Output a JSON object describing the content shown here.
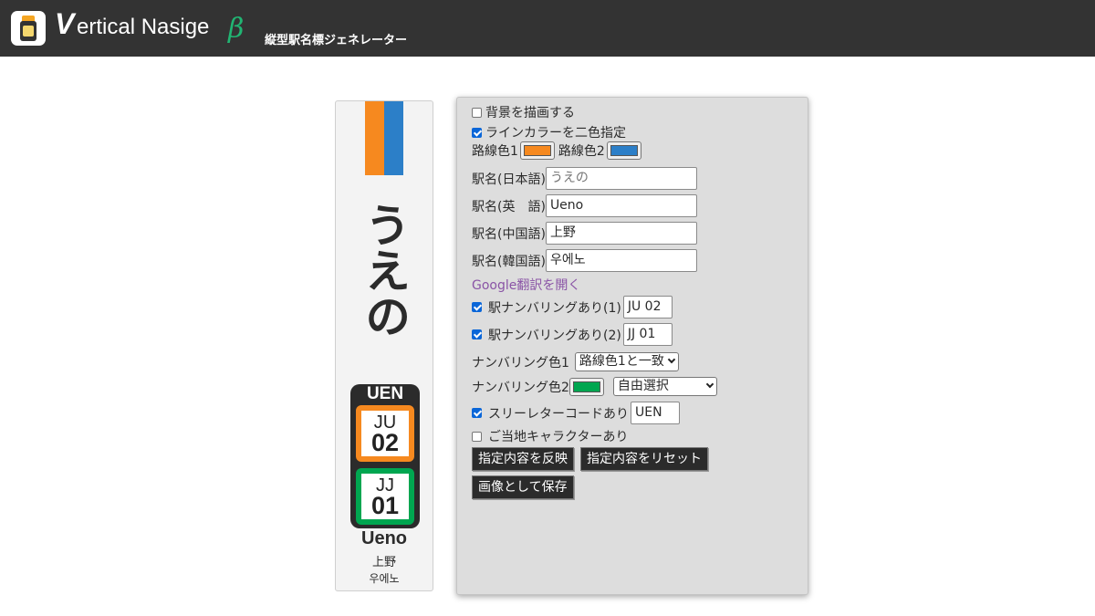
{
  "header": {
    "brand_v": "V",
    "brand_rest": "ertical Nasige",
    "brand_beta": "β",
    "subtitle": "縦型駅名標ジェネレーター",
    "logo_icon": "signboard-logo-icon"
  },
  "sign": {
    "line_color_1": "#f6891f",
    "line_color_2": "#2c7fc8",
    "name_jp": "うえの",
    "three_letter": "UEN",
    "numbering_1": {
      "line": "JU",
      "num": "02",
      "color": "#f6891f"
    },
    "numbering_2": {
      "line": "JJ",
      "num": "01",
      "color": "#00a650"
    },
    "name_en": "Ueno",
    "name_cn": "上野",
    "name_kr": "우에노"
  },
  "form": {
    "draw_background": {
      "label": "背景を描画する",
      "checked": false
    },
    "two_color_line": {
      "label": "ラインカラーを二色指定",
      "checked": true
    },
    "line_color_1_label": "路線色1",
    "line_color_2_label": "路線色2",
    "name_jp_label": "駅名(日本語)",
    "name_jp_placeholder": "うえの",
    "name_en_label": "駅名(英　語)",
    "name_en_value": "Ueno",
    "name_cn_label": "駅名(中国語)",
    "name_cn_value": "上野",
    "name_kr_label": "駅名(韓国語)",
    "name_kr_value": "우에노",
    "google_translate_link": "Google翻訳を開く",
    "numbering_1": {
      "label": "駅ナンバリングあり(1)",
      "checked": true,
      "value": "JU 02"
    },
    "numbering_2": {
      "label": "駅ナンバリングあり(2)",
      "checked": true,
      "value": "JJ 01"
    },
    "numbering_color_1_label": "ナンバリング色1",
    "numbering_color_1_select": "路線色1と一致",
    "numbering_color_2_label": "ナンバリング色2",
    "numbering_color_2_swatch": "#00a650",
    "numbering_color_2_select": "自由選択",
    "three_letter": {
      "label": "スリーレターコードあり",
      "checked": true,
      "value": "UEN"
    },
    "local_character": {
      "label": "ご当地キャラクターあり",
      "checked": false
    },
    "buttons": {
      "apply": "指定内容を反映",
      "reset": "指定内容をリセット",
      "save": "画像として保存"
    }
  }
}
